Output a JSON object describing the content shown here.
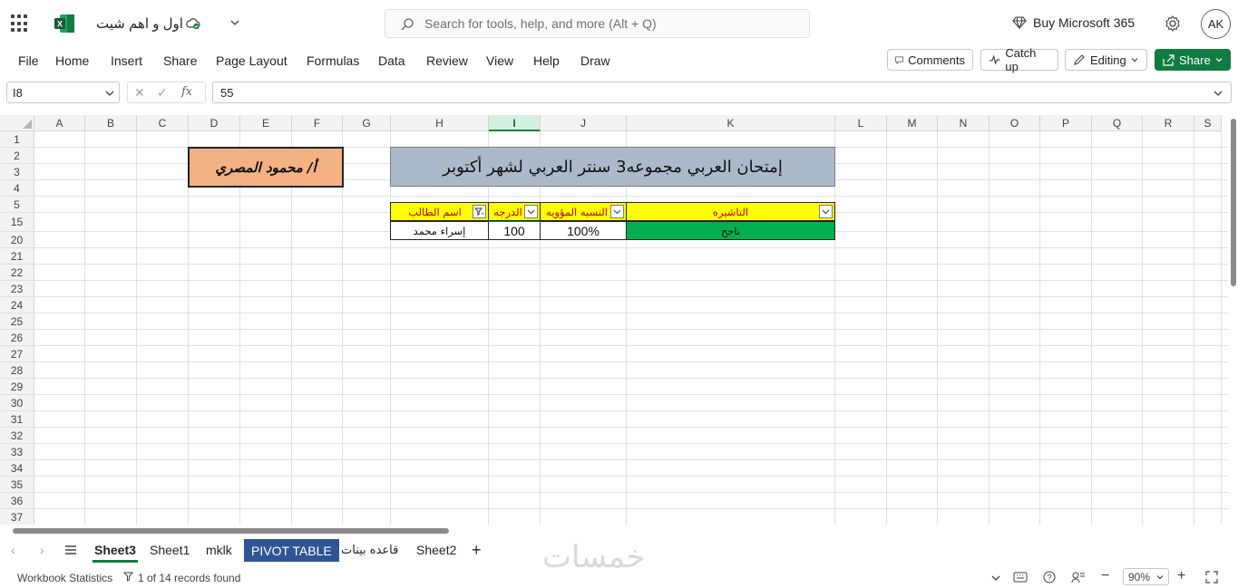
{
  "titlebar": {
    "doc_title": "اول و اهم شيت",
    "search_placeholder": "Search for tools, help, and more (Alt + Q)",
    "buy_label": "Buy Microsoft 365",
    "avatar_initials": "AK"
  },
  "menu": {
    "items": [
      "File",
      "Home",
      "Insert",
      "Share",
      "Page Layout",
      "Formulas",
      "Data",
      "Review",
      "View",
      "Help",
      "Draw"
    ],
    "comments_label": "Comments",
    "catchup_label": "Catch up",
    "editing_label": "Editing",
    "share_label": "Share"
  },
  "formula_bar": {
    "name_box": "I8",
    "fx": "fx",
    "value": "55"
  },
  "columns": [
    "A",
    "B",
    "C",
    "D",
    "E",
    "F",
    "G",
    "H",
    "I",
    "J",
    "K",
    "L",
    "M",
    "N",
    "O",
    "P",
    "Q",
    "R",
    "S"
  ],
  "selected_column": "I",
  "rows": [
    "1",
    "2",
    "3",
    "4",
    "5",
    "15",
    "20",
    "21",
    "22",
    "23",
    "24",
    "25",
    "26",
    "27",
    "28",
    "29",
    "30",
    "31",
    "32",
    "33",
    "34",
    "35",
    "36",
    "37"
  ],
  "sheet": {
    "author": "أ/ محمود المصري",
    "banner": "إمتحان العربي مجموعه3 سنتر العربي لشهر أكتوبر",
    "table_headers": {
      "name": "اسم الطالب",
      "grade": "الدرجه",
      "percent": "النسبه المؤويه",
      "result": "التاشيره"
    },
    "row": {
      "name": "إسراء محمد",
      "grade": "100",
      "percent": "100%",
      "result": "ناجح"
    },
    "colors": {
      "author_fill": "#f4b183",
      "banner_fill": "#acb9ca",
      "header_fill": "#ffff00",
      "header_text": "#c00000",
      "result_fill": "#00b050"
    }
  },
  "tabs": {
    "items": [
      "Sheet3",
      "Sheet1",
      "mklk",
      "PIVOT TABLE",
      "قاعده بينات",
      "Sheet2"
    ],
    "active": "Sheet3"
  },
  "status": {
    "stats_label": "Workbook Statistics",
    "filter_label": "1 of 14 records found",
    "zoom": "90%"
  },
  "watermark": "خمسات"
}
